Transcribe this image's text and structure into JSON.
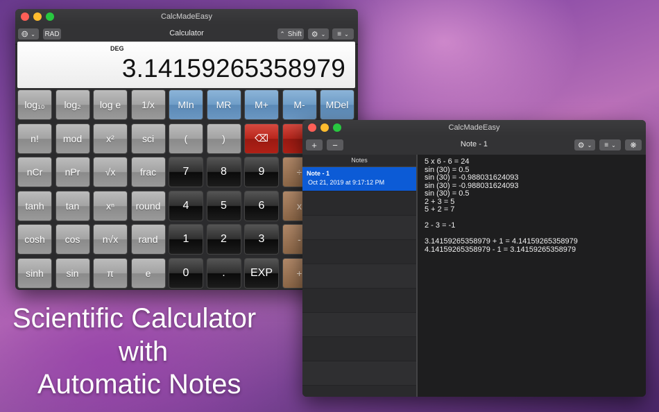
{
  "calculator": {
    "window_title": "CalcMadeEasy",
    "toolbar_title": "Calculator",
    "rad_label": "RAD",
    "shift_label": "Shift",
    "mode": "DEG",
    "display_value": "3.14159265358979",
    "rows": [
      [
        {
          "t": "log₁₀",
          "s": "gray"
        },
        {
          "t": "log₂",
          "s": "gray"
        },
        {
          "t": "log e",
          "s": "gray"
        },
        {
          "t": "1/x",
          "s": "gray"
        },
        {
          "t": "MIn",
          "s": "blue"
        },
        {
          "t": "MR",
          "s": "blue"
        },
        {
          "t": "M+",
          "s": "blue"
        },
        {
          "t": "M-",
          "s": "blue"
        },
        {
          "t": "MDel",
          "s": "blue"
        }
      ],
      [
        {
          "t": "n!",
          "s": "gray"
        },
        {
          "t": "mod",
          "s": "gray"
        },
        {
          "t": "x²",
          "s": "gray"
        },
        {
          "t": "sci",
          "s": "gray"
        },
        {
          "t": "(",
          "s": "gray"
        },
        {
          "t": ")",
          "s": "gray"
        },
        {
          "t": "⌫",
          "s": "red"
        },
        {
          "t": "",
          "s": "red"
        }
      ],
      [
        {
          "t": "nCr",
          "s": "gray"
        },
        {
          "t": "nPr",
          "s": "gray"
        },
        {
          "t": "√x",
          "s": "gray"
        },
        {
          "t": "frac",
          "s": "gray"
        },
        {
          "t": "7",
          "s": "black"
        },
        {
          "t": "8",
          "s": "black"
        },
        {
          "t": "9",
          "s": "black"
        },
        {
          "t": "÷",
          "s": "orange"
        }
      ],
      [
        {
          "t": "tanh",
          "s": "gray"
        },
        {
          "t": "tan",
          "s": "gray"
        },
        {
          "t": "xⁿ",
          "s": "gray"
        },
        {
          "t": "round",
          "s": "gray"
        },
        {
          "t": "4",
          "s": "black"
        },
        {
          "t": "5",
          "s": "black"
        },
        {
          "t": "6",
          "s": "black"
        },
        {
          "t": "x",
          "s": "orange"
        }
      ],
      [
        {
          "t": "cosh",
          "s": "gray"
        },
        {
          "t": "cos",
          "s": "gray"
        },
        {
          "t": "n√x",
          "s": "gray"
        },
        {
          "t": "rand",
          "s": "gray"
        },
        {
          "t": "1",
          "s": "black"
        },
        {
          "t": "2",
          "s": "black"
        },
        {
          "t": "3",
          "s": "black"
        },
        {
          "t": "-",
          "s": "orange"
        }
      ],
      [
        {
          "t": "sinh",
          "s": "gray"
        },
        {
          "t": "sin",
          "s": "gray"
        },
        {
          "t": "π",
          "s": "gray"
        },
        {
          "t": "e",
          "s": "gray"
        },
        {
          "t": "0",
          "s": "black"
        },
        {
          "t": ".",
          "s": "black"
        },
        {
          "t": "EXP",
          "s": "black"
        },
        {
          "t": "+",
          "s": "orange"
        }
      ]
    ]
  },
  "notes_window": {
    "window_title": "CalcMadeEasy",
    "toolbar_title": "Note - 1",
    "add_label": "+",
    "remove_label": "−",
    "sidebar_header": "Notes",
    "selected_note": {
      "title": "Note - 1",
      "date": "Oct 21, 2019 at 9:17:12 PM"
    },
    "empty_rows": 9,
    "lines": [
      "5 x 6 - 6 = 24",
      "sin (30) = 0.5",
      "sin (30) = -0.988031624093",
      "sin (30) = -0.988031624093",
      "sin (30) = 0.5",
      "2 + 3 = 5",
      "5 + 2 = 7",
      "",
      "2 - 3 = -1",
      "",
      "3.14159265358979 + 1 = 4.14159265358979",
      "4.14159265358979 - 1 = 3.14159265358979"
    ]
  },
  "hero": {
    "line1": "Scientific Calculator",
    "line2": "with",
    "line3": "Automatic Notes"
  }
}
